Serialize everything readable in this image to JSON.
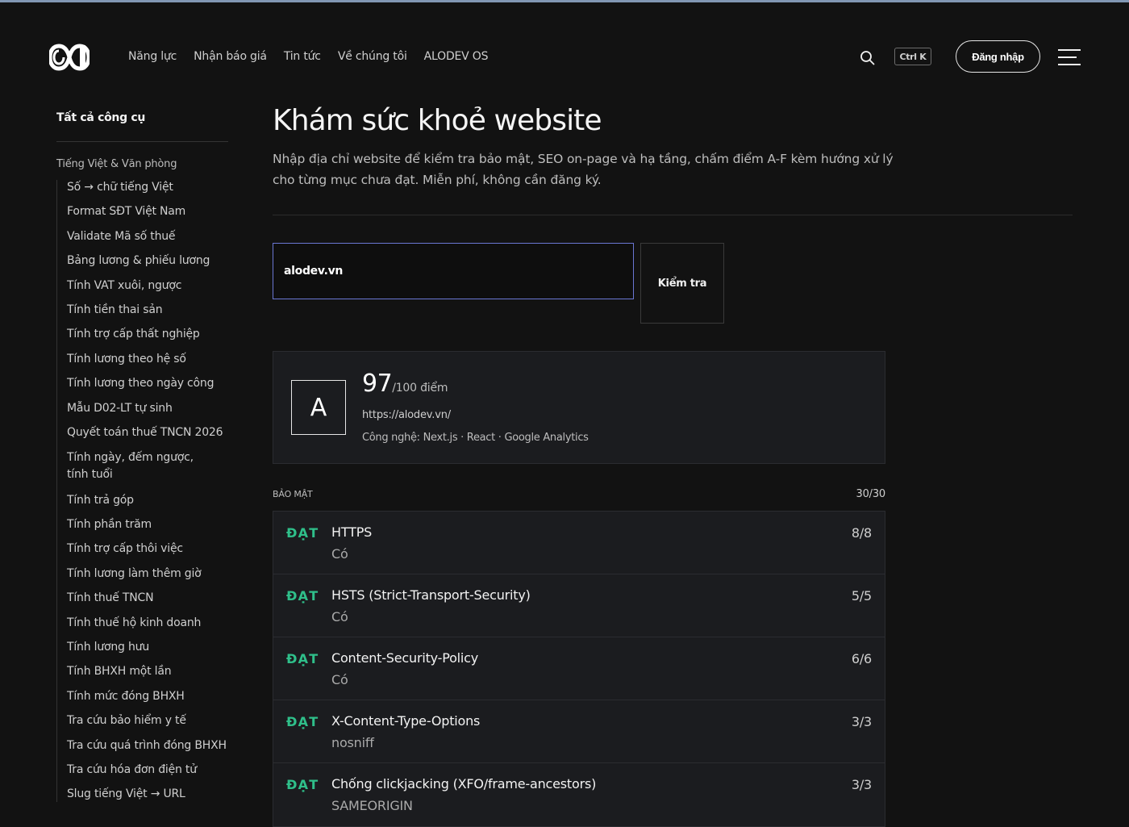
{
  "header": {
    "nav": [
      "Năng lực",
      "Nhận báo giá",
      "Tin tức",
      "Về chúng tôi",
      "ALODEV OS"
    ],
    "shortcut": "Ctrl K",
    "login_label": "Đăng nhập"
  },
  "sidebar": {
    "all_tools": "Tất cả công cụ",
    "group": "Tiếng Việt & Văn phòng",
    "items": [
      "Số → chữ tiếng Việt",
      "Format SĐT Việt Nam",
      "Validate Mã số thuế",
      "Bảng lương & phiếu lương",
      "Tính VAT xuôi, ngược",
      "Tính tiền thai sản",
      "Tính trợ cấp thất nghiệp",
      "Tính lương theo hệ số",
      "Tính lương theo ngày công",
      "Mẫu D02-LT tự sinh",
      "Quyết toán thuế TNCN 2026",
      "Tính ngày, đếm ngược, tính tuổi",
      "Tính trả góp",
      "Tính phần trăm",
      "Tính trợ cấp thôi việc",
      "Tính lương làm thêm giờ",
      "Tính thuế TNCN",
      "Tính thuế hộ kinh doanh",
      "Tính lương hưu",
      "Tính BHXH một lần",
      "Tính mức đóng BHXH",
      "Tra cứu bảo hiểm y tế",
      "Tra cứu quá trình đóng BHXH",
      "Tra cứu hóa đơn điện tử",
      "Slug tiếng Việt → URL"
    ]
  },
  "main": {
    "title": "Khám sức khoẻ website",
    "description": "Nhập địa chỉ website để kiểm tra bảo mật, SEO on-page và hạ tầng, chấm điểm A-F kèm hướng xử lý cho từng mục chưa đạt. Miễn phí, không cần đăng ký.",
    "input_value": "alodev.vn",
    "check_label": "Kiểm tra",
    "result": {
      "grade": "A",
      "score": "97",
      "score_suffix": "/100 điểm",
      "url": "https://alodev.vn/",
      "tech": "Công nghệ: Next.js · React · Google Analytics"
    },
    "section": {
      "label": "BẢO MẬT",
      "score": "30/30",
      "checks": [
        {
          "status": "ĐẠT",
          "name": "HTTPS",
          "value": "Có",
          "points": "8/8"
        },
        {
          "status": "ĐẠT",
          "name": "HSTS (Strict-Transport-Security)",
          "value": "Có",
          "points": "5/5"
        },
        {
          "status": "ĐẠT",
          "name": "Content-Security-Policy",
          "value": "Có",
          "points": "6/6"
        },
        {
          "status": "ĐẠT",
          "name": "X-Content-Type-Options",
          "value": "nosniff",
          "points": "3/3"
        },
        {
          "status": "ĐẠT",
          "name": "Chống clickjacking (XFO/frame-ancestors)",
          "value": "SAMEORIGIN",
          "points": "3/3"
        }
      ]
    }
  },
  "colors": {
    "accent_pass": "#2fbf8a",
    "input_focus": "#6a77d3",
    "top_bar": "#8197b3"
  }
}
